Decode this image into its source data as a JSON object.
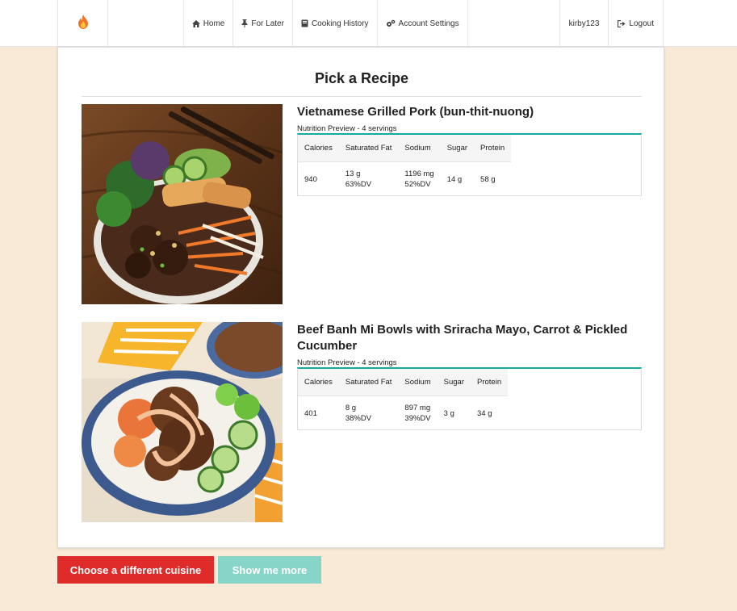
{
  "nav": {
    "brand_icon": "flame-icon",
    "items": [
      {
        "label": "Home",
        "icon": "home-icon"
      },
      {
        "label": "For Later",
        "icon": "pin-icon"
      },
      {
        "label": "Cooking History",
        "icon": "book-icon"
      },
      {
        "label": "Account Settings",
        "icon": "gears-icon"
      }
    ],
    "user": "kirby123",
    "logout": {
      "label": "Logout",
      "icon": "logout-icon"
    }
  },
  "page_title": "Pick a Recipe",
  "recipes": [
    {
      "name": "Vietnamese Grilled Pork (bun-thit-nuong)",
      "nutrition_label": "Nutrition Preview - 4 servings",
      "headers": [
        "Calories",
        "Saturated Fat",
        "Sodium",
        "Sugar",
        "Protein"
      ],
      "values": {
        "calories": "940",
        "sat_fat": "13 g",
        "sat_fat_dv": "63%DV",
        "sodium": "1196 mg",
        "sodium_dv": "52%DV",
        "sugar": "14 g",
        "protein": "58 g"
      }
    },
    {
      "name": "Beef Banh Mi Bowls with Sriracha Mayo, Carrot & Pickled Cucumber",
      "nutrition_label": "Nutrition Preview - 4 servings",
      "headers": [
        "Calories",
        "Saturated Fat",
        "Sodium",
        "Sugar",
        "Protein"
      ],
      "values": {
        "calories": "401",
        "sat_fat": "8 g",
        "sat_fat_dv": "38%DV",
        "sodium": "897 mg",
        "sodium_dv": "39%DV",
        "sugar": "3 g",
        "protein": "34 g"
      }
    }
  ],
  "buttons": {
    "different_cuisine": "Choose a different cuisine",
    "show_more": "Show me more"
  },
  "colors": {
    "page_bg": "#f9ead7",
    "accent_teal": "#17a9a2",
    "primary_red": "#e02b2b",
    "teal_button": "#87d5c8"
  }
}
